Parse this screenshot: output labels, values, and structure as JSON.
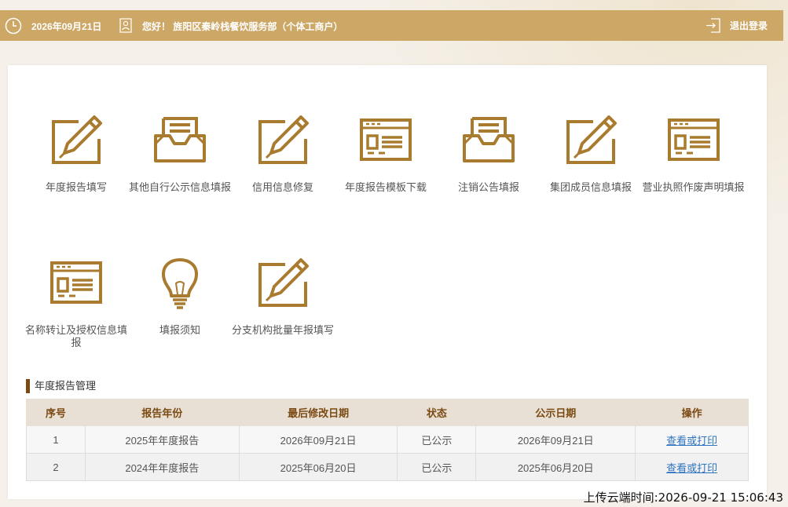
{
  "header": {
    "date": "2026年09月21日",
    "greeting": "您好！ 旌阳区秦岭栈餐饮服务部（个体工商户）",
    "logout_label": "退出登录"
  },
  "tiles": [
    {
      "label": "年度报告填写",
      "icon": "edit-pencil-icon"
    },
    {
      "label": "其他自行公示信息填报",
      "icon": "inbox-tray-icon"
    },
    {
      "label": "信用信息修复",
      "icon": "edit-pencil-icon"
    },
    {
      "label": "年度报告模板下载",
      "icon": "template-window-icon"
    },
    {
      "label": "注销公告填报",
      "icon": "inbox-tray-icon"
    },
    {
      "label": "集团成员信息填报",
      "icon": "edit-pencil-icon"
    },
    {
      "label": "营业执照作废声明填报",
      "icon": "template-window-icon"
    },
    {
      "label": "名称转让及授权信息填报",
      "icon": "template-window-icon"
    },
    {
      "label": "填报须知",
      "icon": "lightbulb-icon"
    },
    {
      "label": "分支机构批量年报填写",
      "icon": "edit-pencil-icon"
    }
  ],
  "annual_reports": {
    "title": "年度报告管理",
    "columns": [
      "序号",
      "报告年份",
      "最后修改日期",
      "状态",
      "公示日期",
      "操作"
    ],
    "rows": [
      {
        "index": "1",
        "year": "2025年年度报告",
        "modified": "2026年09月21日",
        "status": "已公示",
        "published": "2026年09月21日",
        "action": "查看或打印"
      },
      {
        "index": "2",
        "year": "2024年年度报告",
        "modified": "2025年06月20日",
        "status": "已公示",
        "published": "2025年06月20日",
        "action": "查看或打印"
      }
    ]
  },
  "upload_time": "上传云端时间:2026-09-21 15:06:43",
  "colors": {
    "header_bg": "#cda766",
    "icon_gold": "#a97b2f",
    "table_header_text": "#7b4a12",
    "link": "#2f74c0"
  }
}
